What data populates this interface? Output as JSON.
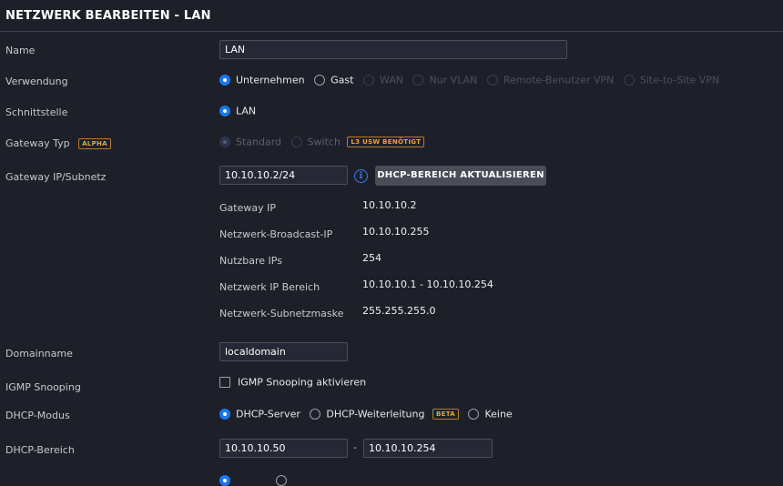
{
  "title": "NETZWERK BEARBEITEN - LAN",
  "name": {
    "label": "Name",
    "value": "LAN"
  },
  "verwendung": {
    "label": "Verwendung",
    "options": [
      "Unternehmen",
      "Gast",
      "WAN",
      "Nur VLAN",
      "Remote-Benutzer VPN",
      "Site-to-Site VPN"
    ],
    "selected": "Unternehmen"
  },
  "schnittstelle": {
    "label": "Schnittstelle",
    "option": "LAN"
  },
  "gateway_typ": {
    "label": "Gateway Typ",
    "badge": "ALPHA",
    "options": [
      "Standard",
      "Switch"
    ],
    "switch_badge": "L3 USW BENÖTIGT"
  },
  "gateway_ip": {
    "label": "Gateway IP/Subnetz",
    "value": "10.10.10.2/24",
    "info_icon": "i",
    "button": "DHCP-BEREICH AKTUALISIEREN"
  },
  "details": [
    {
      "label": "Gateway IP",
      "value": "10.10.10.2"
    },
    {
      "label": "Netzwerk-Broadcast-IP",
      "value": "10.10.10.255"
    },
    {
      "label": "Nutzbare IPs",
      "value": "254"
    },
    {
      "label": "Netzwerk IP Bereich",
      "value": "10.10.10.1 - 10.10.10.254"
    },
    {
      "label": "Netzwerk-Subnetzmaske",
      "value": "255.255.255.0"
    }
  ],
  "domainname": {
    "label": "Domainname",
    "value": "localdomain"
  },
  "igmp": {
    "label": "IGMP Snooping",
    "checkbox_label": "IGMP Snooping aktivieren"
  },
  "dhcp_modus": {
    "label": "DHCP-Modus",
    "options": [
      "DHCP-Server",
      "DHCP-Weiterleitung",
      "Keine"
    ],
    "badge": "BETA"
  },
  "dhcp_bereich": {
    "label": "DHCP-Bereich",
    "start": "10.10.10.50",
    "separator": "-",
    "end": "10.10.10.254"
  },
  "colors": {
    "background": "#1e2029",
    "accent": "#1a79ee",
    "badge": "#f1a234",
    "button": "#4a4d57"
  }
}
